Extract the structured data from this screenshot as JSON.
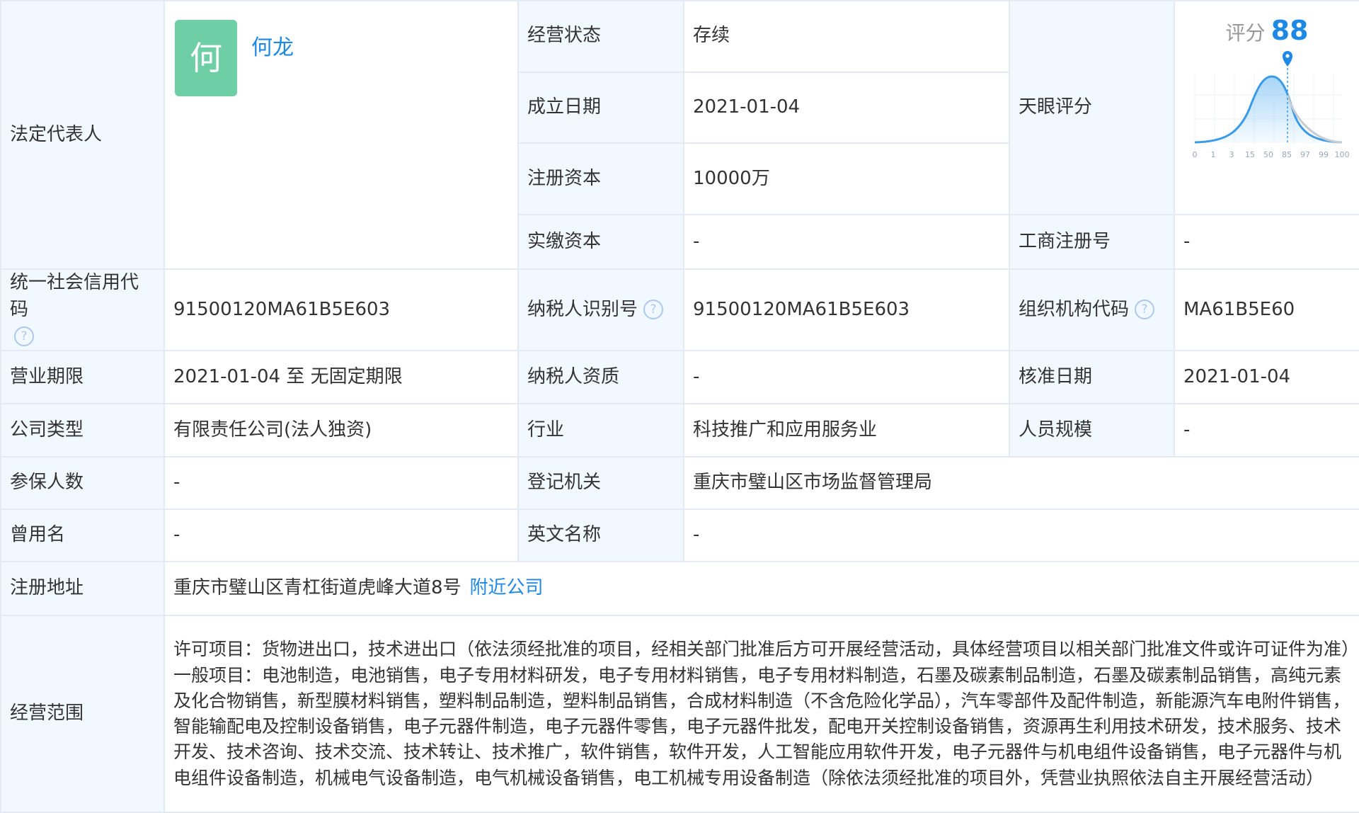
{
  "legal_rep": {
    "label": "法定代表人",
    "avatar_char": "何",
    "name": "何龙"
  },
  "status": {
    "label": "经营状态",
    "value": "存续"
  },
  "found_date": {
    "label": "成立日期",
    "value": "2021-01-04"
  },
  "reg_capital": {
    "label": "注册资本",
    "value": "10000万"
  },
  "paid_capital": {
    "label": "实缴资本",
    "value": "-"
  },
  "tianyan": {
    "label": "天眼评分",
    "score_label": "评分",
    "score": "88",
    "axis_ticks": [
      "0",
      "1",
      "3",
      "15",
      "50",
      "85",
      "97",
      "99",
      "100"
    ]
  },
  "biz_reg_no": {
    "label": "工商注册号",
    "value": "-"
  },
  "credit_code": {
    "label": "统一社会信用代码",
    "value": "91500120MA61B5E603"
  },
  "taxpayer_id": {
    "label": "纳税人识别号",
    "value": "91500120MA61B5E603"
  },
  "org_code": {
    "label": "组织机构代码",
    "value": "MA61B5E60"
  },
  "term": {
    "label": "营业期限",
    "value": "2021-01-04 至 无固定期限"
  },
  "taxpayer_qual": {
    "label": "纳税人资质",
    "value": "-"
  },
  "approve_date": {
    "label": "核准日期",
    "value": "2021-01-04"
  },
  "company_type": {
    "label": "公司类型",
    "value": "有限责任公司(法人独资)"
  },
  "industry": {
    "label": "行业",
    "value": "科技推广和应用服务业"
  },
  "staff_size": {
    "label": "人员规模",
    "value": "-"
  },
  "insured": {
    "label": "参保人数",
    "value": "-"
  },
  "reg_authority": {
    "label": "登记机关",
    "value": "重庆市璧山区市场监督管理局"
  },
  "former_name": {
    "label": "曾用名",
    "value": "-"
  },
  "english_name": {
    "label": "英文名称",
    "value": "-"
  },
  "address": {
    "label": "注册地址",
    "value": "重庆市璧山区青杠街道虎峰大道8号",
    "link": "附近公司"
  },
  "scope": {
    "label": "经营范围",
    "value": "许可项目：货物进出口，技术进出口（依法须经批准的项目，经相关部门批准后方可开展经营活动，具体经营项目以相关部门批准文件或许可证件为准）一般项目：电池制造，电池销售，电子专用材料研发，电子专用材料销售，电子专用材料制造，石墨及碳素制品制造，石墨及碳素制品销售，高纯元素及化合物销售，新型膜材料销售，塑料制品制造，塑料制品销售，合成材料制造（不含危险化学品），汽车零部件及配件制造，新能源汽车电附件销售，智能输配电及控制设备销售，电子元器件制造，电子元器件零售，电子元器件批发，配电开关控制设备销售，资源再生利用技术研发，技术服务、技术开发、技术咨询、技术交流、技术转让、技术推广，软件销售，软件开发，人工智能应用软件开发，电子元器件与机电组件设备销售，电子元器件与机电组件设备制造，机械电气设备制造，电气机械设备销售，电工机械专用设备制造（除依法须经批准的项目外，凭营业执照依法自主开展经营活动）"
  },
  "colors": {
    "label_bg": "#f2f8ff",
    "border": "#e4eaf3",
    "link": "#1e88e5",
    "avatar": "#6ecfa7"
  }
}
